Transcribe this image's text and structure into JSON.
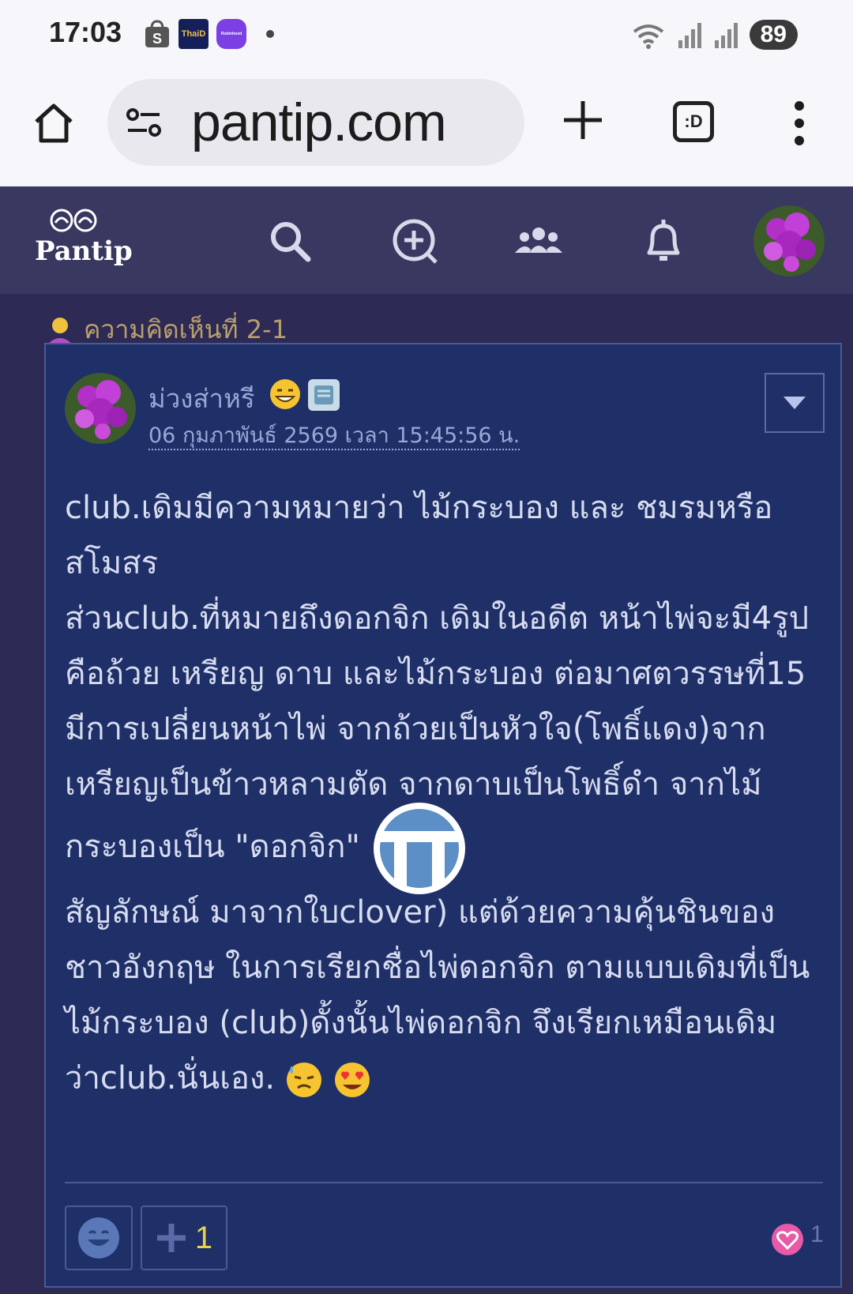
{
  "status_bar": {
    "time": "17:03",
    "battery": "89",
    "apps": [
      "shopee-icon",
      "thaid-icon",
      "robinhood-icon"
    ],
    "app_labels": [
      "ThaiD",
      "Robinhood"
    ]
  },
  "browser": {
    "url": "pantip.com",
    "tabs_label": ":D"
  },
  "nav": {
    "logo_text": "Pantip",
    "icons": [
      "search-icon",
      "new-topic-icon",
      "community-icon",
      "notification-icon"
    ]
  },
  "comment_ref": "ความคิดเห็นที่ 2-1",
  "post": {
    "username": "ม่วงส่าหรี",
    "date": "06 กุมภาพันธ์ 2569 เวลา 15:45:56 น.",
    "lines": [
      "club.เดิมมีความหมายว่า ไม้กระบอง และ ชมรมหรือสโมสร",
      "ส่วนclub.ที่หมายถึงดอกจิก เดิมในอดีต หน้าไพ่จะมี4รูป คือถ้วย เหรียญ ดาบ และไม้กระบอง ต่อมาศตวรรษที่15 มีการเปลี่ยนหน้าไพ่ จากถ้วยเป็นหัวใจ(โพธิ์แดง)จากเหรียญเป็นข้าวหลามตัด จากดาบเป็นโพธิ์ดำ จากไม้กระบองเป็น \"ดอกจิก\"",
      "สัญลักษณ์ มาจากใบclover) แต่ด้วยความคุ้นชินของชาวอังกฤษ ในการเรียกชื่อไพ่ดอกจิก ตามแบบเดิมที่เป็นไม้กระบอง (club)ดั้งนั้นไพ่ดอกจิก จึงเรียกเหมือนเดิมว่าclub.นั่นเอง."
    ],
    "plus_count": "1",
    "heart_count": "1"
  },
  "colors": {
    "nav_bg": "#393860",
    "card_bg": "#1f2f68",
    "text": "#d7dcef",
    "meta": "#9aa7d6",
    "comment_ref": "#b9a06a"
  }
}
